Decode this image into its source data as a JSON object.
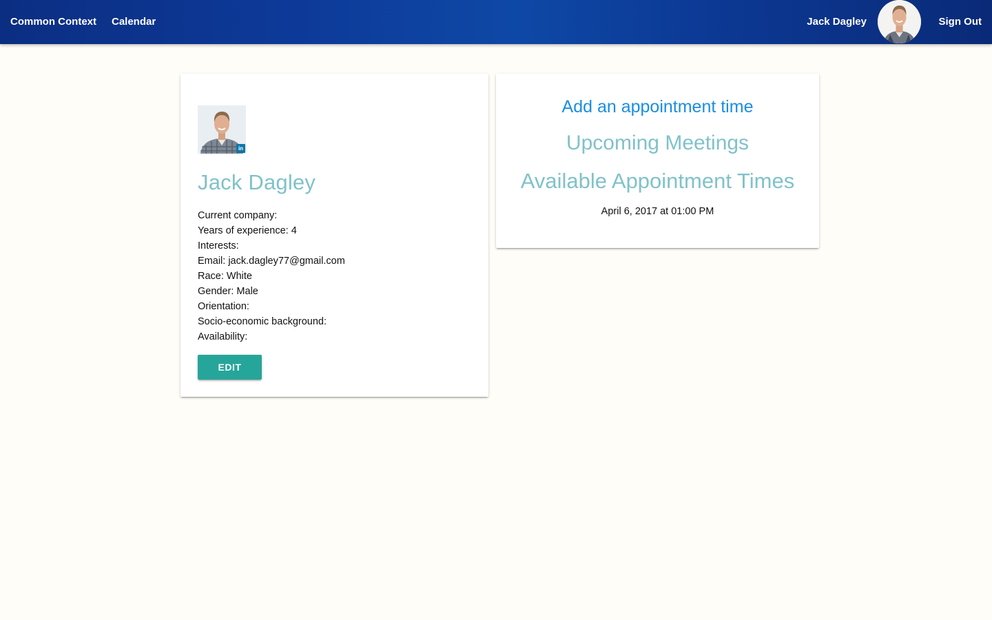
{
  "nav": {
    "brand": "Common Context",
    "calendar": "Calendar",
    "user_name": "Jack Dagley",
    "sign_out": "Sign Out",
    "avatar_icon": "user-avatar-photo",
    "background_colors": [
      "#0b2e82",
      "#0e48a6",
      "#0a2a78"
    ]
  },
  "profile": {
    "name": "Jack Dagley",
    "photo_badge": "in",
    "details": [
      "Current company:",
      "Years of experience: 4",
      "Interests:",
      "Email: jack.dagley77@gmail.com",
      "Race: White",
      "Gender: Male",
      "Orientation:",
      "Socio-economic background:",
      "Availability:"
    ],
    "edit_label": "Edit"
  },
  "schedule": {
    "add_appointment": "Add an appointment time",
    "upcoming_heading": "Upcoming Meetings",
    "available_heading": "Available Appointment Times",
    "available_times": [
      "April 6, 2017 at 01:00 PM"
    ]
  },
  "colors": {
    "page_background": "#fffdf8",
    "heading_teal": "#80c2c9",
    "link_blue": "#1a8ee0",
    "button_teal": "#26a69a",
    "linkedin_blue": "#0e76a8"
  }
}
